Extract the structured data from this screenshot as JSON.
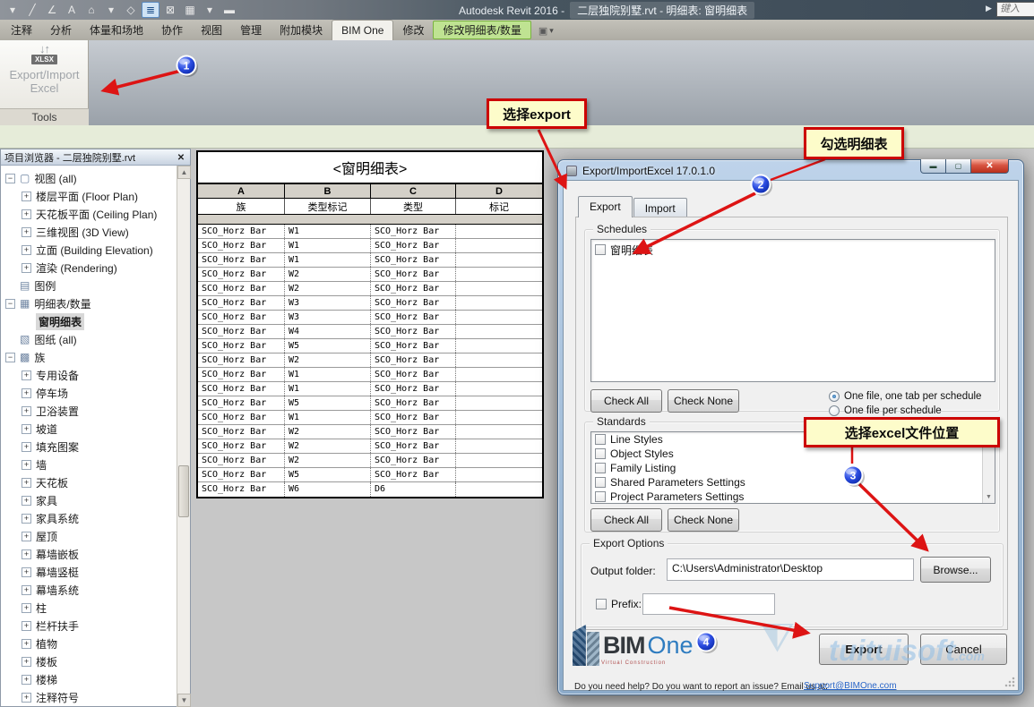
{
  "title_bar": {
    "app_title": "Autodesk Revit 2016 -",
    "doc_title": "二层独院别墅.rvt - 明细表: 窗明细表",
    "expand_glyph": "▶",
    "search_text": "键入"
  },
  "qat": [
    {
      "name": "qat-customize-caret-icon",
      "glyph": "▾"
    },
    {
      "name": "measure-icon",
      "glyph": "╱"
    },
    {
      "name": "aligned-dimension-icon",
      "glyph": "∠"
    },
    {
      "name": "text-icon",
      "glyph": "A"
    },
    {
      "name": "default-3d-view-icon",
      "glyph": "⌂"
    },
    {
      "name": "3d-view-caret-icon",
      "glyph": "▾"
    },
    {
      "name": "section-icon",
      "glyph": "◇"
    },
    {
      "name": "thin-lines-icon",
      "glyph": "≣",
      "cls": "activeq"
    },
    {
      "name": "close-hidden-windows-icon",
      "glyph": "⊠"
    },
    {
      "name": "switch-windows-icon",
      "glyph": "▦"
    },
    {
      "name": "switch-windows-caret-icon",
      "glyph": "▾"
    },
    {
      "name": "qat-more-icon",
      "glyph": "▬"
    }
  ],
  "ribbon": {
    "tabs": [
      {
        "name": "tab-annotate",
        "label": "注释",
        "cls": ""
      },
      {
        "name": "tab-analyze",
        "label": "分析",
        "cls": ""
      },
      {
        "name": "tab-massing-site",
        "label": "体量和场地",
        "cls": ""
      },
      {
        "name": "tab-collaborate",
        "label": "协作",
        "cls": ""
      },
      {
        "name": "tab-view",
        "label": "视图",
        "cls": ""
      },
      {
        "name": "tab-manage",
        "label": "管理",
        "cls": ""
      },
      {
        "name": "tab-addins",
        "label": "附加模块",
        "cls": ""
      },
      {
        "name": "tab-bim-one",
        "label": "BIM One",
        "cls": "active"
      },
      {
        "name": "tab-modify",
        "label": "修改",
        "cls": ""
      },
      {
        "name": "tab-modify-schedule",
        "label": "修改明细表/数量",
        "cls": "green"
      }
    ],
    "collapse_box_glyph": "▣",
    "collapse_caret_glyph": "▾",
    "panel": {
      "icon_arrows": "↓↑",
      "icon_chip": "XLSX",
      "button_label_line1": "Export/Import",
      "button_label_line2": "Excel",
      "caption": "Tools"
    }
  },
  "browser": {
    "header": "项目浏览器 - 二层独院别墅.rvt",
    "close_glyph": "✕",
    "scroll_up_glyph": "▲",
    "scroll_down_glyph": "▼",
    "items": [
      {
        "label": "视图 (all)",
        "toggle": "−",
        "icon": "▢",
        "cls": "lvl0"
      },
      {
        "label": "楼层平面 (Floor Plan)",
        "toggle": "+",
        "icon": "",
        "cls": "lvl1"
      },
      {
        "label": "天花板平面 (Ceiling Plan)",
        "toggle": "+",
        "icon": "",
        "cls": "lvl1"
      },
      {
        "label": "三维视图 (3D View)",
        "toggle": "+",
        "icon": "",
        "cls": "lvl1"
      },
      {
        "label": "立面 (Building Elevation)",
        "toggle": "+",
        "icon": "",
        "cls": "lvl1"
      },
      {
        "label": "渲染 (Rendering)",
        "toggle": "+",
        "icon": "",
        "cls": "lvl1"
      },
      {
        "label": "图例",
        "toggle": "",
        "icon": "▤",
        "cls": "lvl0i"
      },
      {
        "label": "明细表/数量",
        "toggle": "−",
        "icon": "▦",
        "cls": "lvl0"
      },
      {
        "label": "窗明细表",
        "toggle": "",
        "icon": "",
        "cls": "lvl1 sel"
      },
      {
        "label": "图纸 (all)",
        "toggle": "",
        "icon": "▧",
        "cls": "lvl0i"
      },
      {
        "label": "族",
        "toggle": "−",
        "icon": "▩",
        "cls": "lvl0"
      },
      {
        "label": "专用设备",
        "toggle": "+",
        "icon": "",
        "cls": "lvl1"
      },
      {
        "label": "停车场",
        "toggle": "+",
        "icon": "",
        "cls": "lvl1"
      },
      {
        "label": "卫浴装置",
        "toggle": "+",
        "icon": "",
        "cls": "lvl1"
      },
      {
        "label": "坡道",
        "toggle": "+",
        "icon": "",
        "cls": "lvl1"
      },
      {
        "label": "填充图案",
        "toggle": "+",
        "icon": "",
        "cls": "lvl1"
      },
      {
        "label": "墙",
        "toggle": "+",
        "icon": "",
        "cls": "lvl1"
      },
      {
        "label": "天花板",
        "toggle": "+",
        "icon": "",
        "cls": "lvl1"
      },
      {
        "label": "家具",
        "toggle": "+",
        "icon": "",
        "cls": "lvl1"
      },
      {
        "label": "家具系统",
        "toggle": "+",
        "icon": "",
        "cls": "lvl1"
      },
      {
        "label": "屋顶",
        "toggle": "+",
        "icon": "",
        "cls": "lvl1"
      },
      {
        "label": "幕墙嵌板",
        "toggle": "+",
        "icon": "",
        "cls": "lvl1"
      },
      {
        "label": "幕墙竖梃",
        "toggle": "+",
        "icon": "",
        "cls": "lvl1"
      },
      {
        "label": "幕墙系统",
        "toggle": "+",
        "icon": "",
        "cls": "lvl1"
      },
      {
        "label": "柱",
        "toggle": "+",
        "icon": "",
        "cls": "lvl1"
      },
      {
        "label": "栏杆扶手",
        "toggle": "+",
        "icon": "",
        "cls": "lvl1"
      },
      {
        "label": "植物",
        "toggle": "+",
        "icon": "",
        "cls": "lvl1"
      },
      {
        "label": "楼板",
        "toggle": "+",
        "icon": "",
        "cls": "lvl1"
      },
      {
        "label": "楼梯",
        "toggle": "+",
        "icon": "",
        "cls": "lvl1"
      },
      {
        "label": "注释符号",
        "toggle": "+",
        "icon": "",
        "cls": "lvl1"
      }
    ]
  },
  "schedule": {
    "title": "<窗明细表>",
    "letters": [
      "A",
      "B",
      "C",
      "D"
    ],
    "headers": [
      "族",
      "类型标记",
      "类型",
      "标记"
    ],
    "rows": [
      {
        "a": "SCO_Horz Bar",
        "b": "W1",
        "c": "SCO_Horz Bar",
        "d": ""
      },
      {
        "a": "SCO_Horz Bar",
        "b": "W1",
        "c": "SCO_Horz Bar",
        "d": ""
      },
      {
        "a": "SCO_Horz Bar",
        "b": "W1",
        "c": "SCO_Horz Bar",
        "d": ""
      },
      {
        "a": "SCO_Horz Bar",
        "b": "W2",
        "c": "SCO_Horz Bar",
        "d": ""
      },
      {
        "a": "SCO_Horz Bar",
        "b": "W2",
        "c": "SCO_Horz Bar",
        "d": ""
      },
      {
        "a": "SCO_Horz Bar",
        "b": "W3",
        "c": "SCO_Horz Bar",
        "d": ""
      },
      {
        "a": "SCO_Horz Bar",
        "b": "W3",
        "c": "SCO_Horz Bar",
        "d": ""
      },
      {
        "a": "SCO_Horz Bar",
        "b": "W4",
        "c": "SCO_Horz Bar",
        "d": ""
      },
      {
        "a": "SCO_Horz Bar",
        "b": "W5",
        "c": "SCO_Horz Bar",
        "d": ""
      },
      {
        "a": "SCO_Horz Bar",
        "b": "W2",
        "c": "SCO_Horz Bar",
        "d": ""
      },
      {
        "a": "SCO_Horz Bar",
        "b": "W1",
        "c": "SCO_Horz Bar",
        "d": ""
      },
      {
        "a": "SCO_Horz Bar",
        "b": "W1",
        "c": "SCO_Horz Bar",
        "d": ""
      },
      {
        "a": "SCO_Horz Bar",
        "b": "W5",
        "c": "SCO_Horz Bar",
        "d": ""
      },
      {
        "a": "SCO_Horz Bar",
        "b": "W1",
        "c": "SCO_Horz Bar",
        "d": ""
      },
      {
        "a": "SCO_Horz Bar",
        "b": "W2",
        "c": "SCO_Horz Bar",
        "d": ""
      },
      {
        "a": "SCO_Horz Bar",
        "b": "W2",
        "c": "SCO_Horz Bar",
        "d": ""
      },
      {
        "a": "SCO_Horz Bar",
        "b": "W2",
        "c": "SCO_Horz Bar",
        "d": ""
      },
      {
        "a": "SCO_Horz Bar",
        "b": "W5",
        "c": "SCO_Horz Bar",
        "d": ""
      },
      {
        "a": "SCO_Horz Bar",
        "b": "W6",
        "c": "D6",
        "d": ""
      }
    ]
  },
  "dialog": {
    "title": "Export/ImportExcel 17.0.1.0",
    "min_glyph": "▬",
    "max_glyph": "▢",
    "close_glyph": "✕",
    "tabs": [
      {
        "name": "dialog-tab-export",
        "label": "Export",
        "cls": "active"
      },
      {
        "name": "dialog-tab-import",
        "label": "Import",
        "cls": ""
      }
    ],
    "schedules": {
      "label": "Schedules",
      "items": [
        {
          "label": "窗明细表"
        }
      ],
      "check_all": "Check All",
      "check_none": "Check None",
      "radios": [
        {
          "label": "One file, one tab per schedule",
          "cls": "selected"
        },
        {
          "label": "One file per schedule",
          "cls": ""
        }
      ]
    },
    "standards": {
      "label": "Standards",
      "items": [
        {
          "label": "Line Styles"
        },
        {
          "label": "Object Styles"
        },
        {
          "label": "Family Listing"
        },
        {
          "label": "Shared Parameters Settings"
        },
        {
          "label": "Project Parameters Settings"
        }
      ],
      "check_all": "Check All",
      "check_none": "Check None",
      "scroll_up_glyph": "▲",
      "scroll_down_glyph": "▼"
    },
    "export_options": {
      "label": "Export Options",
      "output_folder_label": "Output folder:",
      "output_folder_value": "C:\\Users\\Administrator\\Desktop",
      "browse_label": "Browse...",
      "prefix_label": "Prefix:",
      "prefix_value": ""
    },
    "logo": {
      "bim": "BIM",
      "one": "One",
      "tagline": "Virtual Construction"
    },
    "export_label": "Export",
    "cancel_label": "Cancel",
    "help_text": "Do you need help? Do you want to report an issue? Email us at:",
    "help_link": "Support@BIMOne.com"
  },
  "annotations": {
    "callout_export": "选择export",
    "callout_schedule": "勾选明细表",
    "callout_excel": "选择excel文件位置",
    "step1": "1",
    "step2": "2",
    "step3": "3",
    "step4": "4",
    "arrow_color": "#dd1414"
  },
  "watermark": {
    "text": "tuituisoft",
    "suffix": ".com"
  }
}
